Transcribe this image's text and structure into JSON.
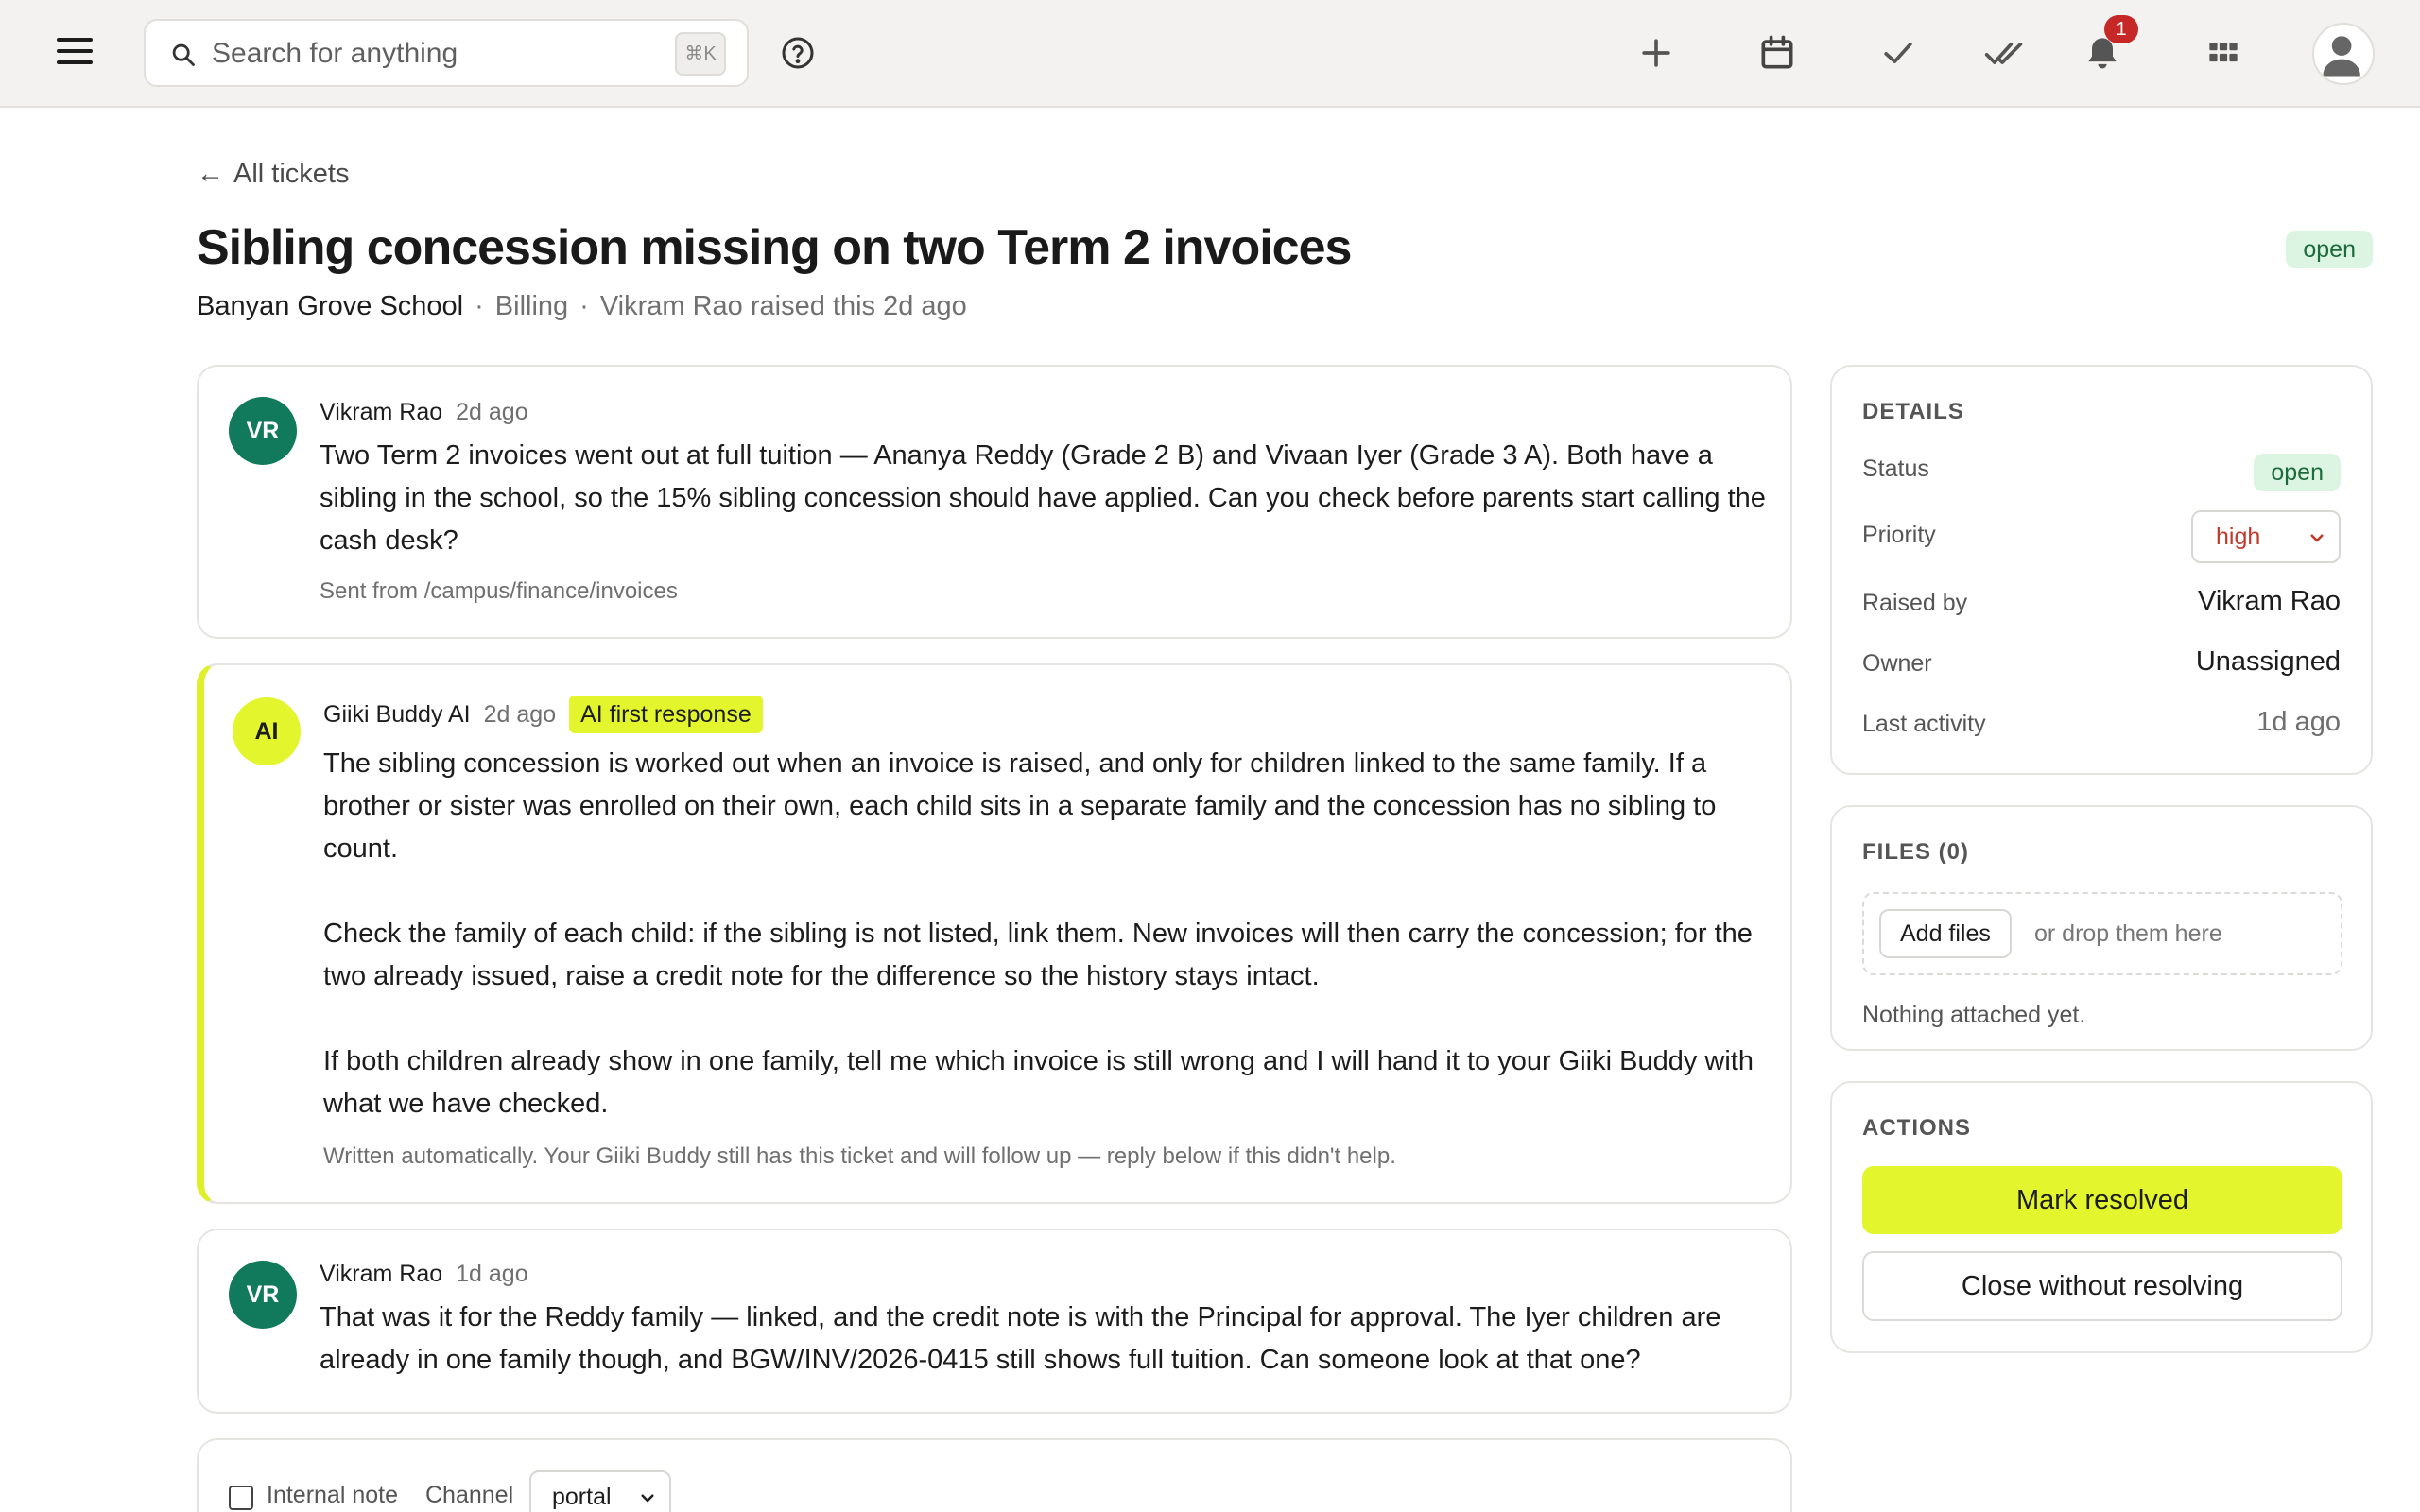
{
  "topbar": {
    "search_placeholder": "Search for anything",
    "search_shortcut": "⌘K",
    "notification_count": "1",
    "icons": [
      "menu-icon",
      "search-icon",
      "help-icon",
      "plus-icon",
      "calendar-icon",
      "check-icon",
      "double-check-icon",
      "bell-icon",
      "grid-icon",
      "user-icon"
    ]
  },
  "header": {
    "back_label": "All tickets",
    "title": "Sibling concession missing on two Term 2 invoices",
    "status": "open",
    "school": "Banyan Grove School",
    "category": "Billing",
    "raised_text": "Vikram Rao raised this 2d ago"
  },
  "messages": [
    {
      "initials": "VR",
      "author": "Vikram Rao",
      "time": "2d ago",
      "body": "Two Term 2 invoices went out at full tuition — Ananya Reddy (Grade 2 B) and Vivaan Iyer (Grade 3 A). Both have a sibling in the school, so the 15% sibling concession should have applied. Can you check before parents start calling the cash desk?",
      "footer": "Sent from /campus/finance/invoices"
    },
    {
      "initials": "AI",
      "author": "Giiki Buddy AI",
      "time": "2d ago",
      "chip": "AI first response",
      "paragraphs": [
        "The sibling concession is worked out when an invoice is raised, and only for children linked to the same family. If a brother or sister was enrolled on their own, each child sits in a separate family and the concession has no sibling to count.",
        "Check the family of each child: if the sibling is not listed, link them. New invoices will then carry the concession; for the two already issued, raise a credit note for the difference so the history stays intact.",
        "If both children already show in one family, tell me which invoice is still wrong and I will hand it to your Giiki Buddy with what we have checked."
      ],
      "footer": "Written automatically. Your Giiki Buddy still has this ticket and will follow up — reply below if this didn't help."
    },
    {
      "initials": "VR",
      "author": "Vikram Rao",
      "time": "1d ago",
      "body": "That was it for the Reddy family — linked, and the credit note is with the Principal for approval. The Iyer children are already in one family though, and BGW/INV/2026-0415 still shows full tuition. Can someone look at that one?"
    }
  ],
  "composer": {
    "internal_note_label": "Internal note",
    "channel_label": "Channel",
    "channel_value": "portal"
  },
  "details": {
    "title": "DETAILS",
    "status_label": "Status",
    "status_value": "open",
    "priority_label": "Priority",
    "priority_value": "high",
    "raised_by_label": "Raised by",
    "raised_by_value": "Vikram Rao",
    "owner_label": "Owner",
    "owner_value": "Unassigned",
    "last_activity_label": "Last activity",
    "last_activity_value": "1d ago"
  },
  "files": {
    "title": "FILES (0)",
    "add_button": "Add files",
    "drop_hint": "or drop them here",
    "empty_text": "Nothing attached yet."
  },
  "actions": {
    "title": "ACTIONS",
    "resolve_button": "Mark resolved",
    "close_button": "Close without resolving"
  },
  "colors": {
    "accent": "#e3f52c",
    "avatar_green": "#127a5c",
    "status_green_bg": "#dcf5e2",
    "status_green_text": "#1d6b3a",
    "priority_red": "#c0392b",
    "badge_red": "#c62828"
  }
}
